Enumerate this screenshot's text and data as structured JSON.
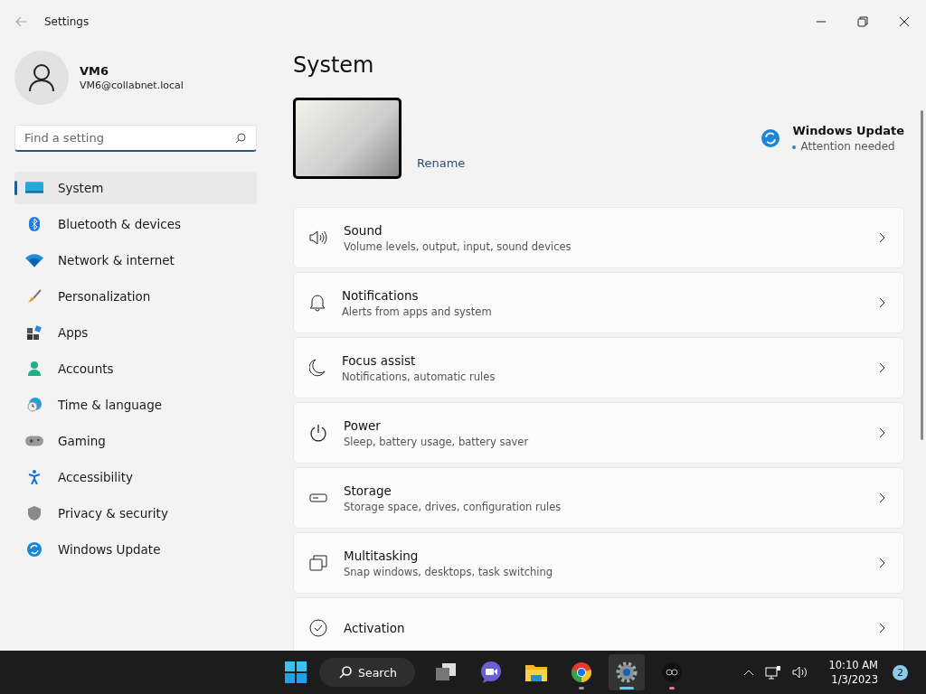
{
  "window": {
    "title": "Settings"
  },
  "account": {
    "name": "VM6",
    "email": "VM6@collabnet.local"
  },
  "search": {
    "placeholder": "Find a setting"
  },
  "sidebar": {
    "items": [
      {
        "label": "System",
        "selected": true
      },
      {
        "label": "Bluetooth & devices",
        "selected": false
      },
      {
        "label": "Network & internet",
        "selected": false
      },
      {
        "label": "Personalization",
        "selected": false
      },
      {
        "label": "Apps",
        "selected": false
      },
      {
        "label": "Accounts",
        "selected": false
      },
      {
        "label": "Time & language",
        "selected": false
      },
      {
        "label": "Gaming",
        "selected": false
      },
      {
        "label": "Accessibility",
        "selected": false
      },
      {
        "label": "Privacy & security",
        "selected": false
      },
      {
        "label": "Windows Update",
        "selected": false
      }
    ]
  },
  "page": {
    "title": "System",
    "rename": "Rename",
    "update": {
      "title": "Windows Update",
      "status": "Attention needed"
    }
  },
  "cards": [
    {
      "title": "Sound",
      "subtitle": "Volume levels, output, input, sound devices"
    },
    {
      "title": "Notifications",
      "subtitle": "Alerts from apps and system"
    },
    {
      "title": "Focus assist",
      "subtitle": "Notifications, automatic rules"
    },
    {
      "title": "Power",
      "subtitle": "Sleep, battery usage, battery saver"
    },
    {
      "title": "Storage",
      "subtitle": "Storage space, drives, configuration rules"
    },
    {
      "title": "Multitasking",
      "subtitle": "Snap windows, desktops, task switching"
    },
    {
      "title": "Activation"
    }
  ],
  "taskbar": {
    "search": "Search",
    "apps": [
      {
        "running": false,
        "selected": false
      },
      {
        "running": false,
        "selected": false
      },
      {
        "running": false,
        "selected": false
      },
      {
        "running": true,
        "selected": false
      },
      {
        "running": true,
        "selected": true
      },
      {
        "running": true,
        "selected": false
      }
    ],
    "time": "10:10 AM",
    "date": "1/3/2023",
    "notifications": "2"
  }
}
